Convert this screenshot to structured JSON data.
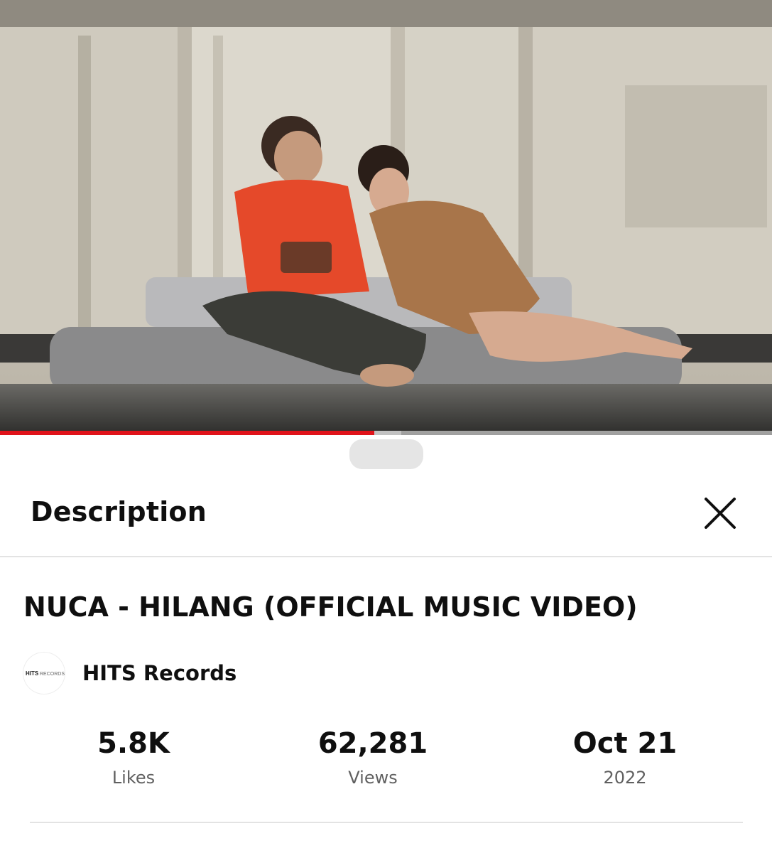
{
  "video": {
    "progress_fraction": 0.485,
    "buffered_fraction": 0.52,
    "progress_color": "#e0131a"
  },
  "panel": {
    "title": "Description",
    "close_icon": "close-icon"
  },
  "video_info": {
    "title": "NUCA - HILANG (OFFICIAL MUSIC VIDEO)",
    "channel": {
      "name": "HITS Records",
      "avatar_text_bold": "HITS",
      "avatar_text_light": "RECORDS"
    }
  },
  "stats": [
    {
      "value": "5.8K",
      "label": "Likes"
    },
    {
      "value": "62,281",
      "label": "Views"
    },
    {
      "value": "Oct 21",
      "label": "2022"
    }
  ]
}
